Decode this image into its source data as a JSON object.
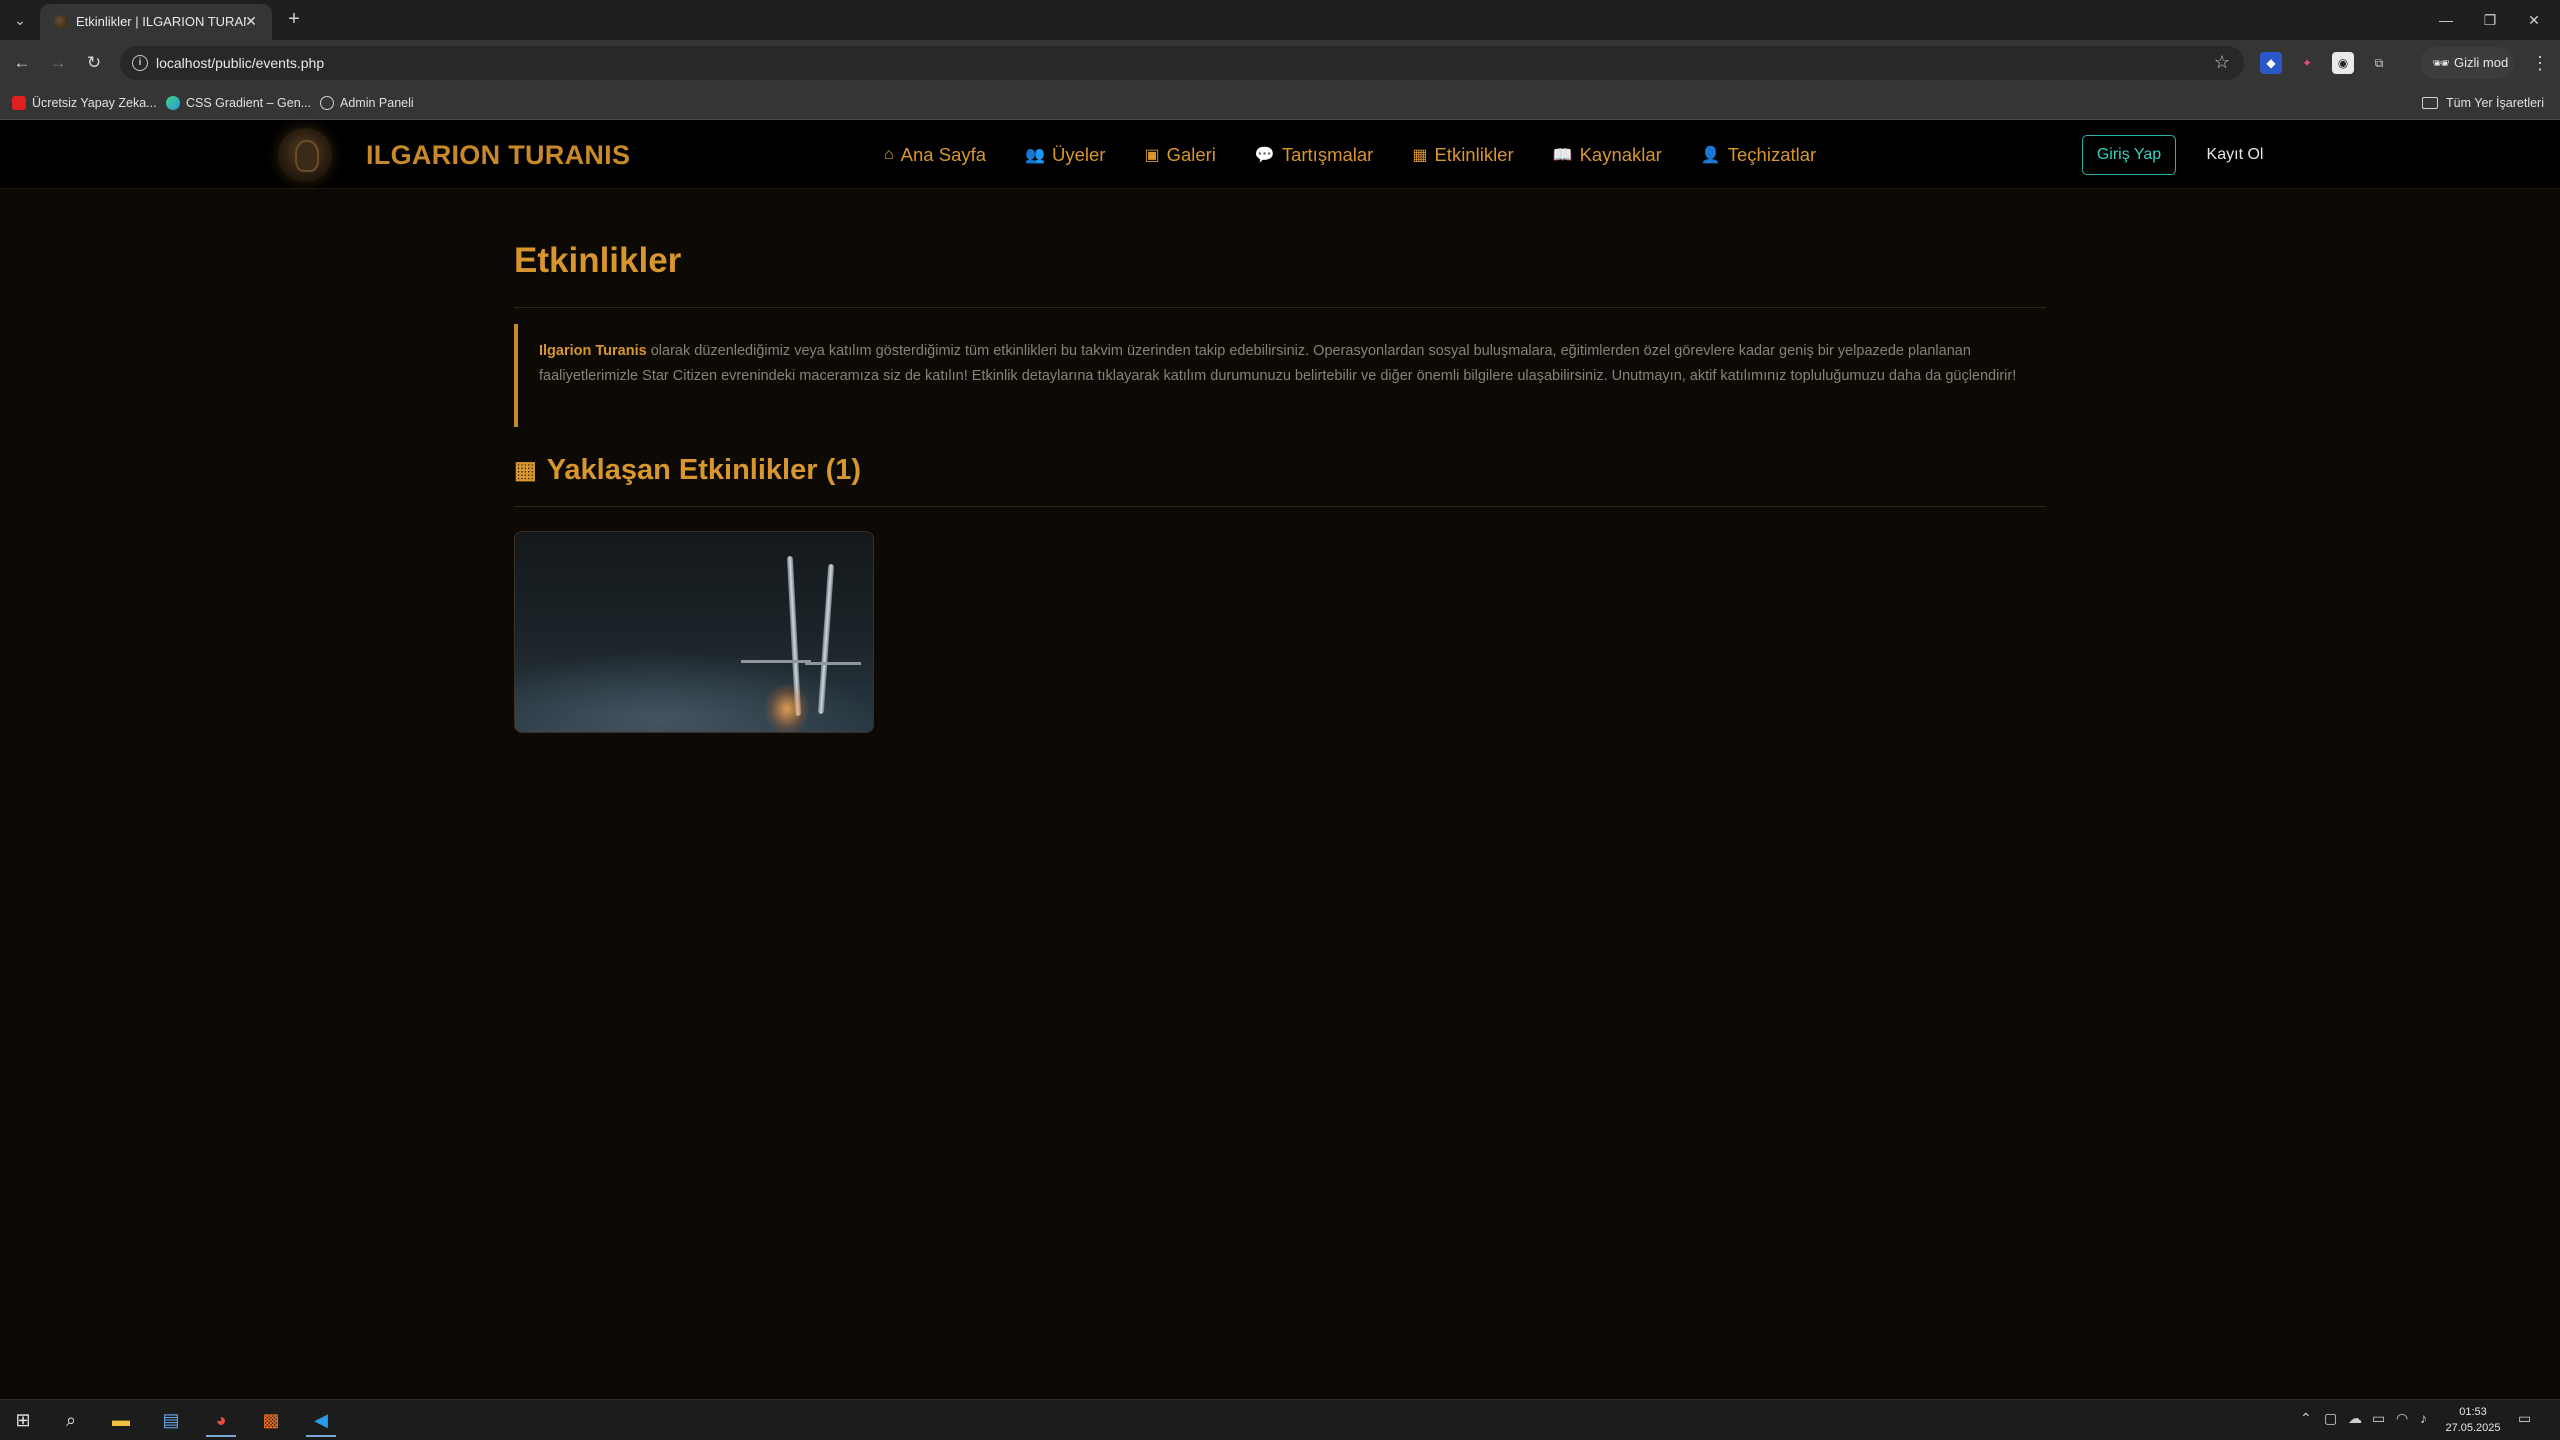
{
  "browser": {
    "tab_title": "Etkinlikler | ILGARION TURANIS",
    "url": "localhost/public/events.php",
    "incognito_label": "Gizli mod",
    "bookmarks": [
      {
        "label": "Ücretsiz Yapay Zeka..."
      },
      {
        "label": "CSS Gradient – Gen..."
      },
      {
        "label": "Admin Paneli"
      }
    ],
    "all_bookmarks_label": "Tüm Yer İşaretleri"
  },
  "site": {
    "brand": "ILGARION TURANIS",
    "nav": [
      {
        "label": "Ana Sayfa",
        "icon": "home-icon"
      },
      {
        "label": "Üyeler",
        "icon": "users-icon"
      },
      {
        "label": "Galeri",
        "icon": "images-icon"
      },
      {
        "label": "Tartışmalar",
        "icon": "comments-icon"
      },
      {
        "label": "Etkinlikler",
        "icon": "calendar-icon"
      },
      {
        "label": "Kaynaklar",
        "icon": "book-icon"
      },
      {
        "label": "Teçhizatlar",
        "icon": "user-gear-icon"
      }
    ],
    "login_label": "Giriş Yap",
    "register_label": "Kayıt Ol"
  },
  "main": {
    "page_title": "Etkinlikler",
    "intro_bold": "Ilgarion Turanis",
    "intro_text": " olarak düzenlediğimiz veya katılım gösterdiğimiz tüm etkinlikleri bu takvim üzerinden takip edebilirsiniz. Operasyonlardan sosyal buluşmalara, eğitimlerden özel görevlere kadar geniş bir yelpazede planlanan faaliyetlerimizle Star Citizen evrenindeki maceramıza siz de katılın! Etkinlik detaylarına tıklayarak katılım durumunuzu belirtebilir ve diğer önemli bilgilere ulaşabilirsiniz. Unutmayın, aktif katılımınız topluluğumuzu daha da güçlendirir!",
    "upcoming_title": "Yaklaşan Etkinlikler (1)"
  },
  "taskbar": {
    "time": "01:53",
    "date": "27.05.2025"
  },
  "colors": {
    "accent": "#d8962e",
    "login_border": "#2bb3a3",
    "page_bg": "#0d0905"
  }
}
